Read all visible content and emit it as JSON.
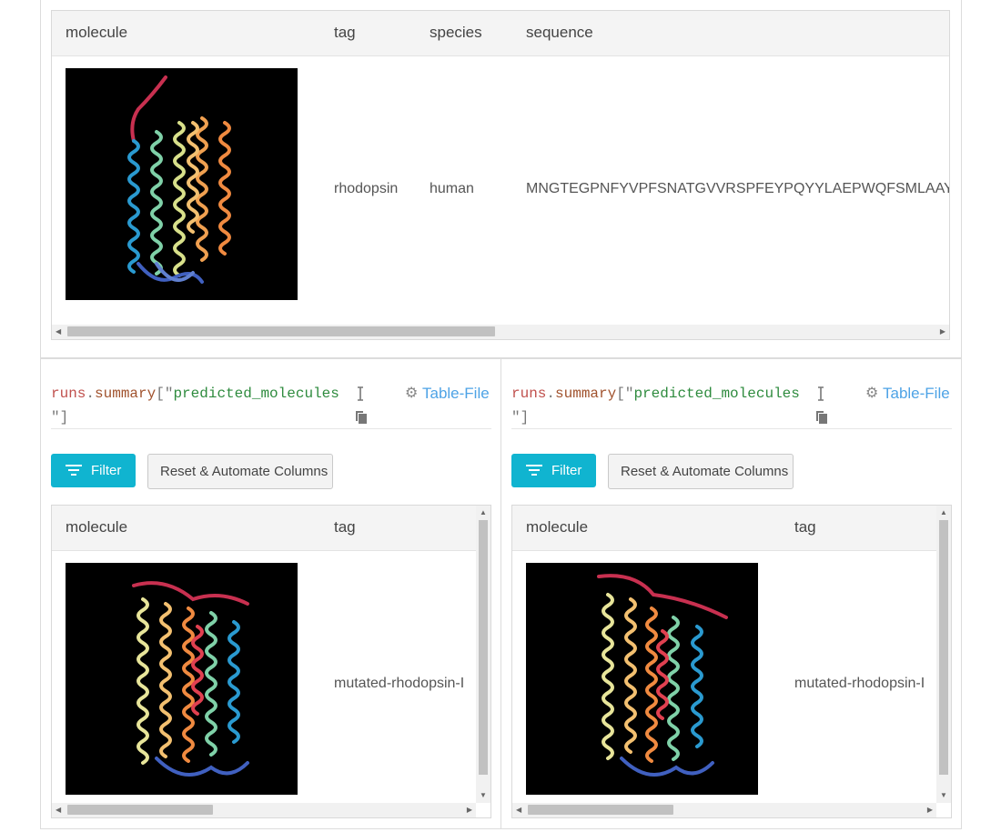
{
  "top_table": {
    "headers": [
      "molecule",
      "tag",
      "species",
      "sequence"
    ],
    "row": {
      "tag": "rhodopsin",
      "species": "human",
      "sequence": "MNGTEGPNFYVPFSNATGVVRSPFEYPQYYLAEPWQFSMLAAYMFLLI"
    }
  },
  "panels": [
    {
      "key_tokens": [
        "runs",
        ".",
        "summary",
        "[\"",
        "predicted_molecules",
        "\"]"
      ],
      "link_label": "Table-File",
      "filter_label": "Filter",
      "reset_label": "Reset & Automate Columns",
      "headers": [
        "molecule",
        "tag"
      ],
      "row_tag": "mutated-rhodopsin-I"
    },
    {
      "key_tokens": [
        "runs",
        ".",
        "summary",
        "[\"",
        "predicted_molecules",
        "\"]"
      ],
      "link_label": "Table-File",
      "filter_label": "Filter",
      "reset_label": "Reset & Automate Columns",
      "headers": [
        "molecule",
        "tag"
      ],
      "row_tag": "mutated-rhodopsin-I"
    }
  ],
  "icons": {
    "text-cursor": "text-cursor-icon",
    "copy": "copy-icon",
    "gear": "gear-icon",
    "filter": "filter-icon"
  },
  "colors": {
    "filter_button": "#10b4d0",
    "link": "#4ea3e6",
    "code_key": "#c0504d",
    "code_string": "#2e8b3e"
  }
}
